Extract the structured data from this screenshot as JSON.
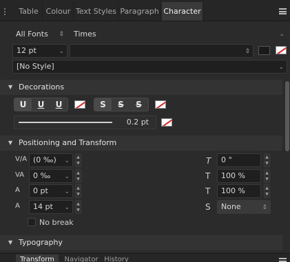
{
  "tabs": [
    {
      "label": "Table"
    },
    {
      "label": "Colour"
    },
    {
      "label": "Text Styles"
    },
    {
      "label": "Paragraph"
    },
    {
      "label": "Character",
      "active": true
    }
  ],
  "font": {
    "collection": "All Fonts",
    "family": "Times",
    "size": "12 pt",
    "style_value": "",
    "para_style": "[No Style]"
  },
  "decorations": {
    "title": "Decorations",
    "underline_buttons": [
      "U",
      "U",
      "U"
    ],
    "strike_buttons": [
      "S",
      "S",
      "S"
    ],
    "line_weight": "0.2 pt"
  },
  "positioning": {
    "title": "Positioning and Transform",
    "kerning": "(0 ‰)",
    "tracking": "0 ‰",
    "baseline": "0 pt",
    "leading": "14 pt",
    "no_break": "No break",
    "shear": "0 °",
    "horiz_scale": "100 %",
    "vert_scale": "100 %",
    "typography_case": "None",
    "icons": {
      "kerning": "V/A",
      "tracking": "VA",
      "baseline": "A",
      "leading": "A",
      "shear": "T",
      "hscale": "T",
      "vscale": "T",
      "case": "S"
    }
  },
  "typography": {
    "title": "Typography"
  },
  "bottom_tabs": [
    "Transform",
    "Navigator",
    "History"
  ],
  "colors": {
    "noslash_red": "#e02020",
    "accent": "#3a3a3a"
  }
}
